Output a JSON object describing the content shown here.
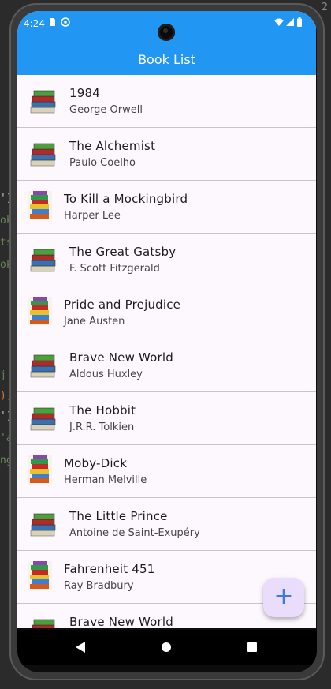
{
  "status": {
    "time": "4:24"
  },
  "appbar": {
    "title": "Book List"
  },
  "books": [
    {
      "title": "1984",
      "author": "George Orwell",
      "thumb": "books-stack-icon"
    },
    {
      "title": "The Alchemist",
      "author": "Paulo Coelho",
      "thumb": "books-stack-icon"
    },
    {
      "title": "To Kill a Mockingbird",
      "author": "Harper Lee",
      "thumb": "books-tall-icon"
    },
    {
      "title": "The Great Gatsby",
      "author": "F. Scott Fitzgerald",
      "thumb": "books-stack-icon"
    },
    {
      "title": "Pride and Prejudice",
      "author": "Jane Austen",
      "thumb": "books-tall-icon"
    },
    {
      "title": "Brave New World",
      "author": "Aldous Huxley",
      "thumb": "books-stack-icon"
    },
    {
      "title": "The Hobbit",
      "author": "J.R.R. Tolkien",
      "thumb": "books-stack-icon"
    },
    {
      "title": "Moby-Dick",
      "author": "Herman Melville",
      "thumb": "books-tall-icon"
    },
    {
      "title": "The Little Prince",
      "author": "Antoine de Saint-Exupéry",
      "thumb": "books-stack-icon"
    },
    {
      "title": "Fahrenheit 451",
      "author": "Ray Bradbury",
      "thumb": "books-tall-icon"
    },
    {
      "title": "Brave New World",
      "author": "",
      "thumb": "books-stack-icon"
    }
  ],
  "fab": {
    "label": "+",
    "icon": "add-icon"
  },
  "colors": {
    "appbar": "#2196f3",
    "list_bg": "#fdf7fe",
    "fab_bg": "#eadcfb",
    "fab_fg": "#3a7be0"
  }
}
